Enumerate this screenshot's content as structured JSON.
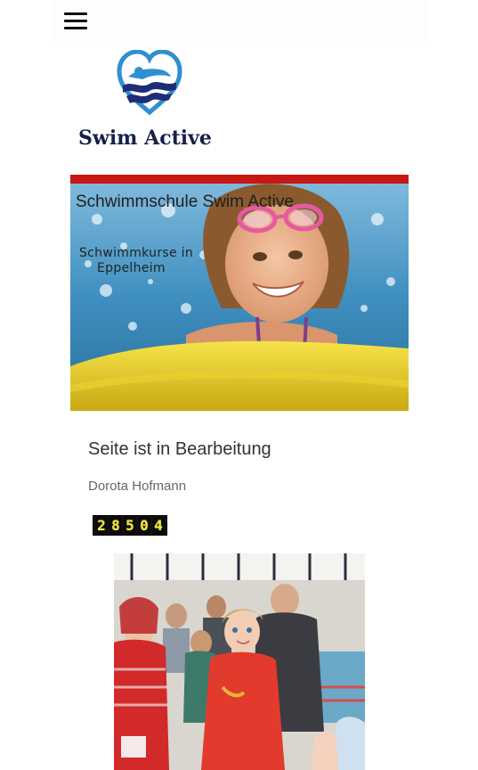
{
  "nav": {
    "menu_icon": "hamburger-menu-icon"
  },
  "logo": {
    "text": "Swim Active",
    "icon": "heart-swimmer-logo"
  },
  "hero": {
    "title": "Schwimmschule Swim Active",
    "subtitle_line1": "Schwimmkurse in",
    "subtitle_line2": "Eppelheim"
  },
  "content": {
    "heading": "Seite ist in Bearbeitung",
    "author": "Dorota Hofmann",
    "visitor_counter": [
      "2",
      "8",
      "5",
      "0",
      "4"
    ]
  },
  "colors": {
    "accent_red": "#c81612",
    "logo_navy": "#16204a",
    "logo_blue": "#2f8fd0",
    "counter_digit": "#f2e64a"
  }
}
